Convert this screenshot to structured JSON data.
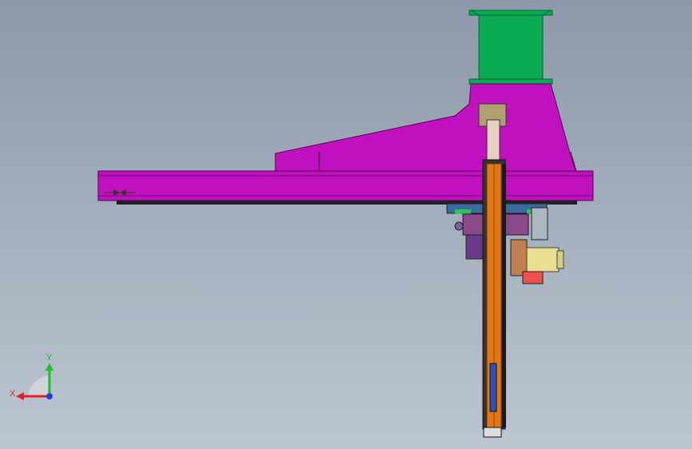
{
  "viewport": {
    "background_top": "#8d98a8",
    "background_bottom": "#bcc6d2"
  },
  "model": {
    "colors": {
      "beam": "#c010c0",
      "beam_edge": "#4a0a4a",
      "column_top": "#0aaa55",
      "mast": "#e07818",
      "carriage": "#8a4a8a",
      "motor": "#e8e090",
      "rail": "#222222"
    }
  },
  "triad": {
    "x_label": "X",
    "y_label": "Y",
    "x_color": "#e02020",
    "y_color": "#20c020",
    "z_color": "#2040e0"
  }
}
